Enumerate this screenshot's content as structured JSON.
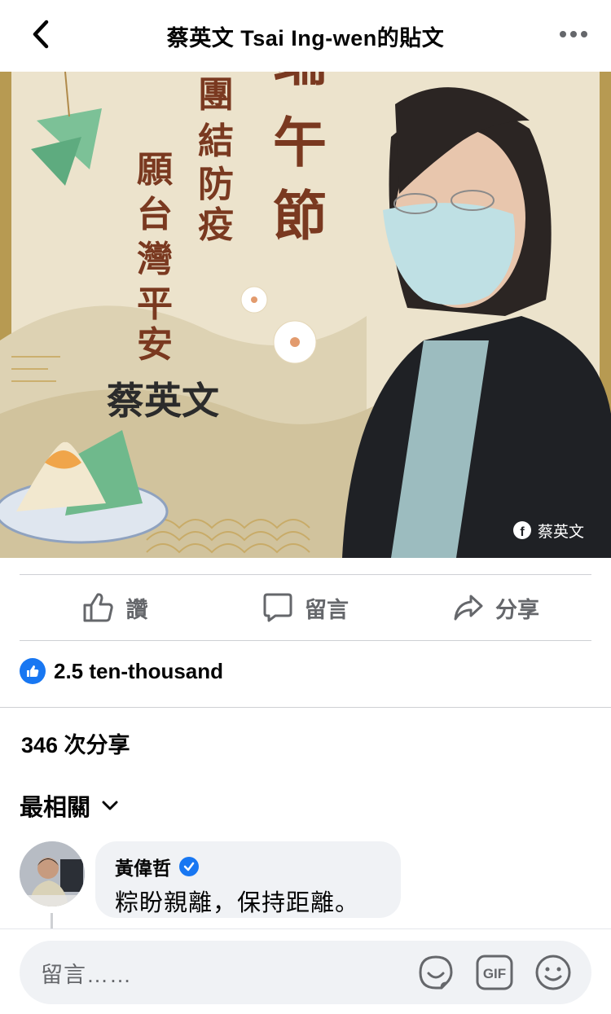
{
  "header": {
    "title": "蔡英文 Tsai Ing-wen的貼文",
    "back_icon": "chevron-left-icon",
    "more_icon": "more-dots-icon"
  },
  "post_image": {
    "headline": "端午節",
    "line1": "團結防疫",
    "line2": "願台灣平安",
    "signature": "蔡英文",
    "watermark": "蔡英文"
  },
  "actions": {
    "like_label": "讚",
    "comment_label": "留言",
    "share_label": "分享"
  },
  "reactions": {
    "count": "2.5 ten-thousand"
  },
  "shares": {
    "text": "346 次分享"
  },
  "sort": {
    "label": "最相關"
  },
  "comment": {
    "author": "黃偉哲",
    "text": "粽盼親離，保持距離。"
  },
  "composer": {
    "placeholder": "留言……"
  },
  "colors": {
    "accent": "#1877f2",
    "secondary_text": "#65676b",
    "bubble_bg": "#f0f2f5",
    "divider": "#ced0d4"
  }
}
